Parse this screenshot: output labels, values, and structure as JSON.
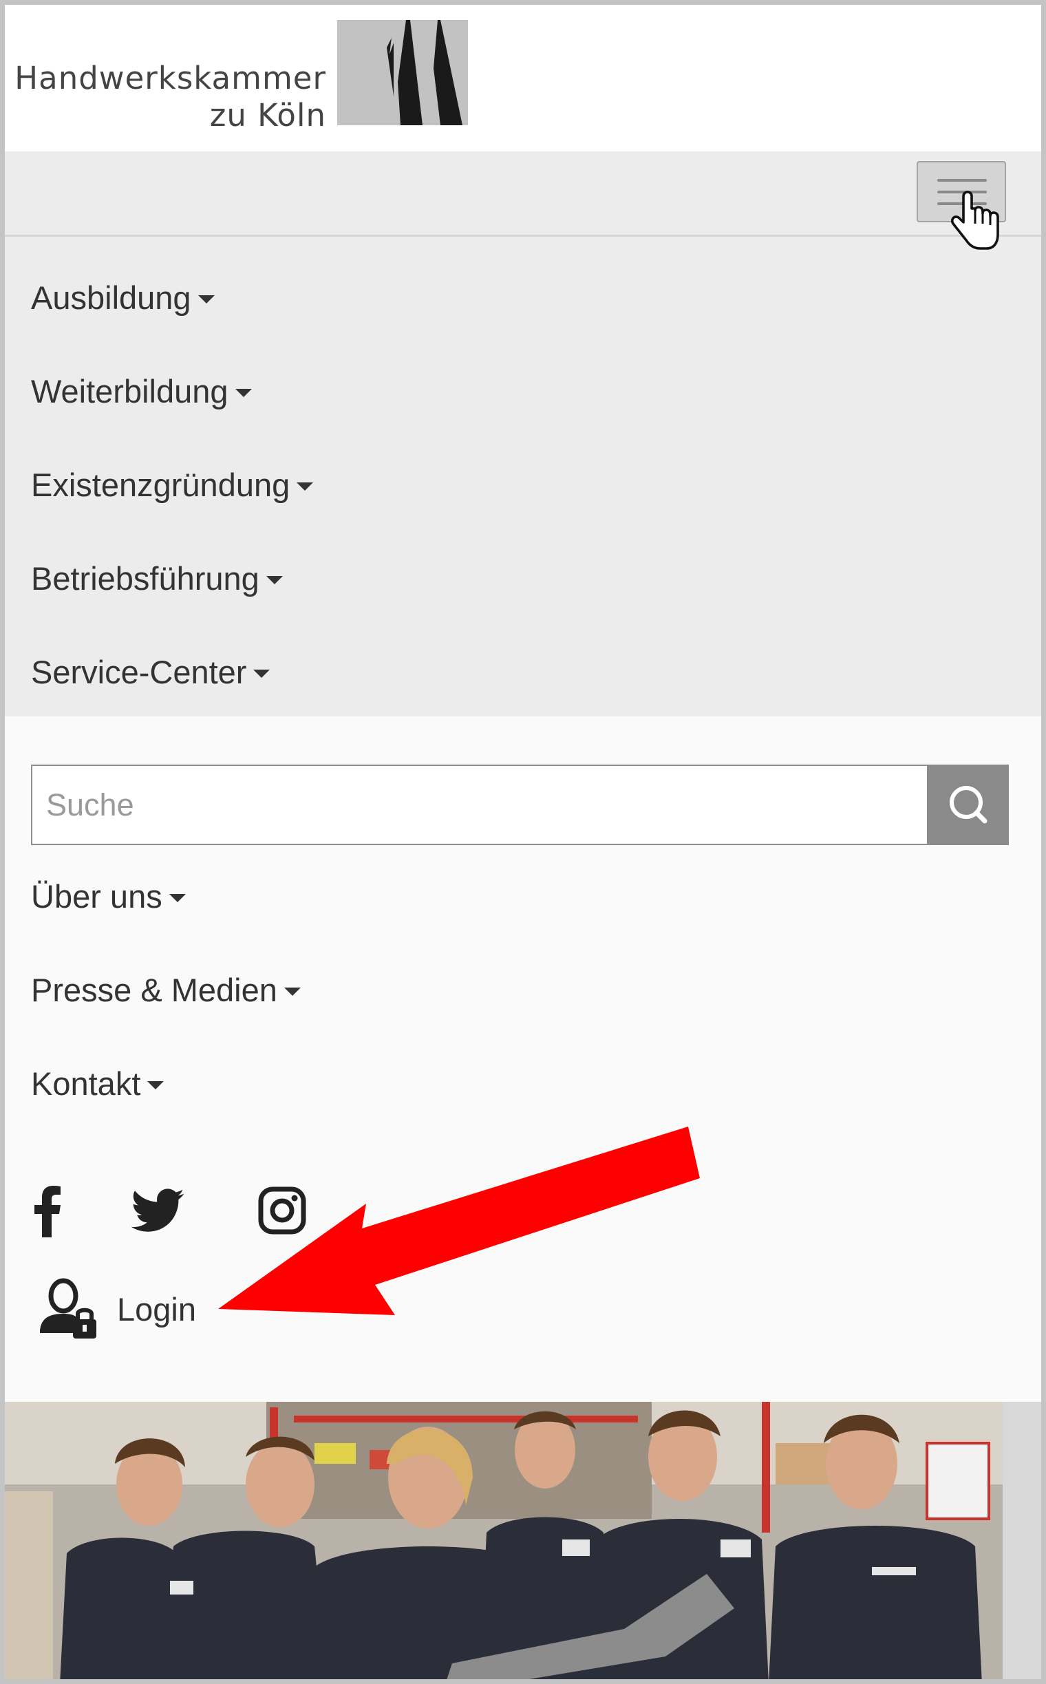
{
  "header": {
    "logo_line1": "Handwerkskammer",
    "logo_line2": "zu Köln",
    "logo_icon": "hwk-logo-mark"
  },
  "toggle": {
    "icon": "hamburger-icon"
  },
  "nav_primary": {
    "items": [
      {
        "label": "Ausbildung"
      },
      {
        "label": "Weiterbildung"
      },
      {
        "label": "Existenzgründung"
      },
      {
        "label": "Betriebsführung"
      },
      {
        "label": "Service-Center"
      }
    ]
  },
  "search": {
    "placeholder": "Suche",
    "icon": "search-icon"
  },
  "nav_secondary": {
    "items": [
      {
        "label": "Über uns"
      },
      {
        "label": "Presse & Medien"
      },
      {
        "label": "Kontakt"
      }
    ]
  },
  "social": [
    {
      "icon": "facebook-icon"
    },
    {
      "icon": "twitter-icon"
    },
    {
      "icon": "instagram-icon"
    }
  ],
  "login": {
    "label": "Login",
    "icon": "user-lock-icon"
  },
  "annotation": {
    "icon": "red-arrow-icon",
    "color": "#ff0000"
  },
  "colors": {
    "nav_bg": "#ececec",
    "section_bg": "#fafafa",
    "text": "#333333",
    "search_button": "#8a8a8a"
  }
}
